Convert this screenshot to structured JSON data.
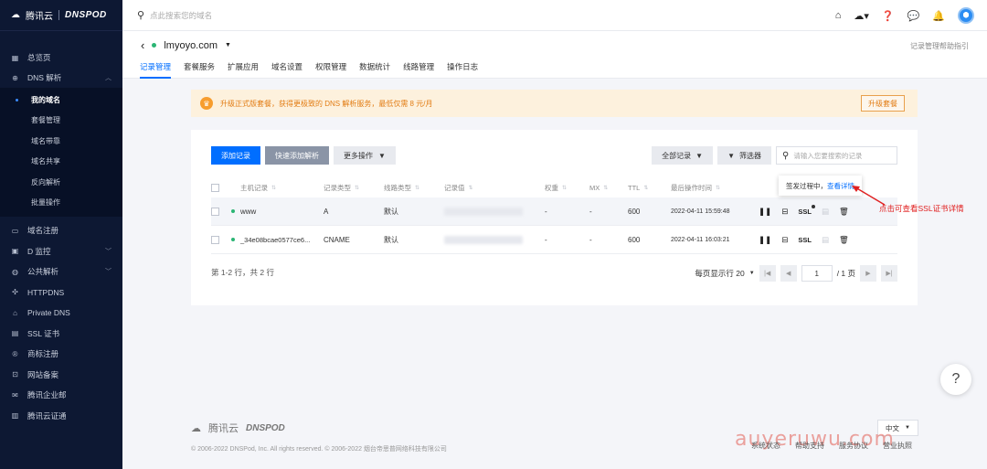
{
  "logo": {
    "brand": "腾讯云",
    "product": "DNSPOD"
  },
  "search": {
    "placeholder": "点此搜索您的域名"
  },
  "sidebar": {
    "top_items": [
      {
        "label": "总览页",
        "icon": "grid-icon"
      },
      {
        "label": "DNS 解析",
        "icon": "globe-icon"
      }
    ],
    "sub_items": [
      "我的域名",
      "套餐管理",
      "域名带靠",
      "域名共享",
      "反向解析",
      "批量操作"
    ],
    "items": [
      {
        "label": "域名注册",
        "icon": "calendar-icon"
      },
      {
        "label": "D 监控",
        "icon": "monitor-icon"
      },
      {
        "label": "公共解析",
        "icon": "public-dns-icon"
      },
      {
        "label": "HTTPDNS",
        "icon": "network-icon"
      },
      {
        "label": "Private DNS",
        "icon": "lock-icon"
      },
      {
        "label": "SSL 证书",
        "icon": "certificate-icon"
      },
      {
        "label": "商标注册",
        "icon": "trademark-icon"
      },
      {
        "label": "网站备案",
        "icon": "record-icon"
      },
      {
        "label": "腾讯企业邮",
        "icon": "mail-icon"
      },
      {
        "label": "腾讯云证通",
        "icon": "id-icon"
      }
    ]
  },
  "header": {
    "domain": "lmyoyo.com",
    "help": "记录管理帮助指引",
    "tabs": [
      "记录管理",
      "套餐服务",
      "扩展应用",
      "域名设置",
      "权限管理",
      "数据统计",
      "线路管理",
      "操作日志"
    ]
  },
  "banner": {
    "text": "升级正式版套餐，获得更极致的 DNS 解析服务，最低仅需 8 元/月",
    "button": "升级套餐"
  },
  "toolbar": {
    "add": "添加记录",
    "quick": "快速添加解析",
    "more": "更多操作",
    "all_records": "全部记录",
    "filter": "筛选器",
    "search_placeholder": "请输入您要搜索的记录"
  },
  "table": {
    "columns": [
      "主机记录",
      "记录类型",
      "线路类型",
      "记录值",
      "权重",
      "MX",
      "TTL",
      "最后操作时间"
    ],
    "rows": [
      {
        "host": "www",
        "type": "A",
        "line": "默认",
        "weight": "-",
        "mx": "-",
        "ttl": "600",
        "time": "2022-04-11 15:59:48"
      },
      {
        "host": "_34e08bcae0577ce6...",
        "type": "CNAME",
        "line": "默认",
        "weight": "-",
        "mx": "-",
        "ttl": "600",
        "time": "2022-04-11 16:03:21"
      }
    ],
    "ssl_label": "SSL"
  },
  "tooltip": {
    "text": "签发过程中，",
    "link": "查看详情"
  },
  "pagination": {
    "summary": "第 1-2 行，共 2 行",
    "per_page": "每页显示行 20",
    "page": "1",
    "total": "/ 1 页"
  },
  "annotation": "点击可查看SSL证书详情",
  "footer": {
    "brand": "腾讯云",
    "product": "DNSPOD",
    "copyright": "© 2006-2022 DNSPod, Inc. All rights reserved. © 2006-2022 烟台帝思普网络科技有限公司",
    "language": "中文",
    "links": [
      "系统状态",
      "帮助支持",
      "服务协议",
      "营业执照"
    ]
  },
  "watermark": "auyeruwu.com",
  "colors": {
    "accent": "#006eff",
    "sidebar": "#0d1833",
    "annotation": "#e02020",
    "banner_text": "#e27c13"
  }
}
